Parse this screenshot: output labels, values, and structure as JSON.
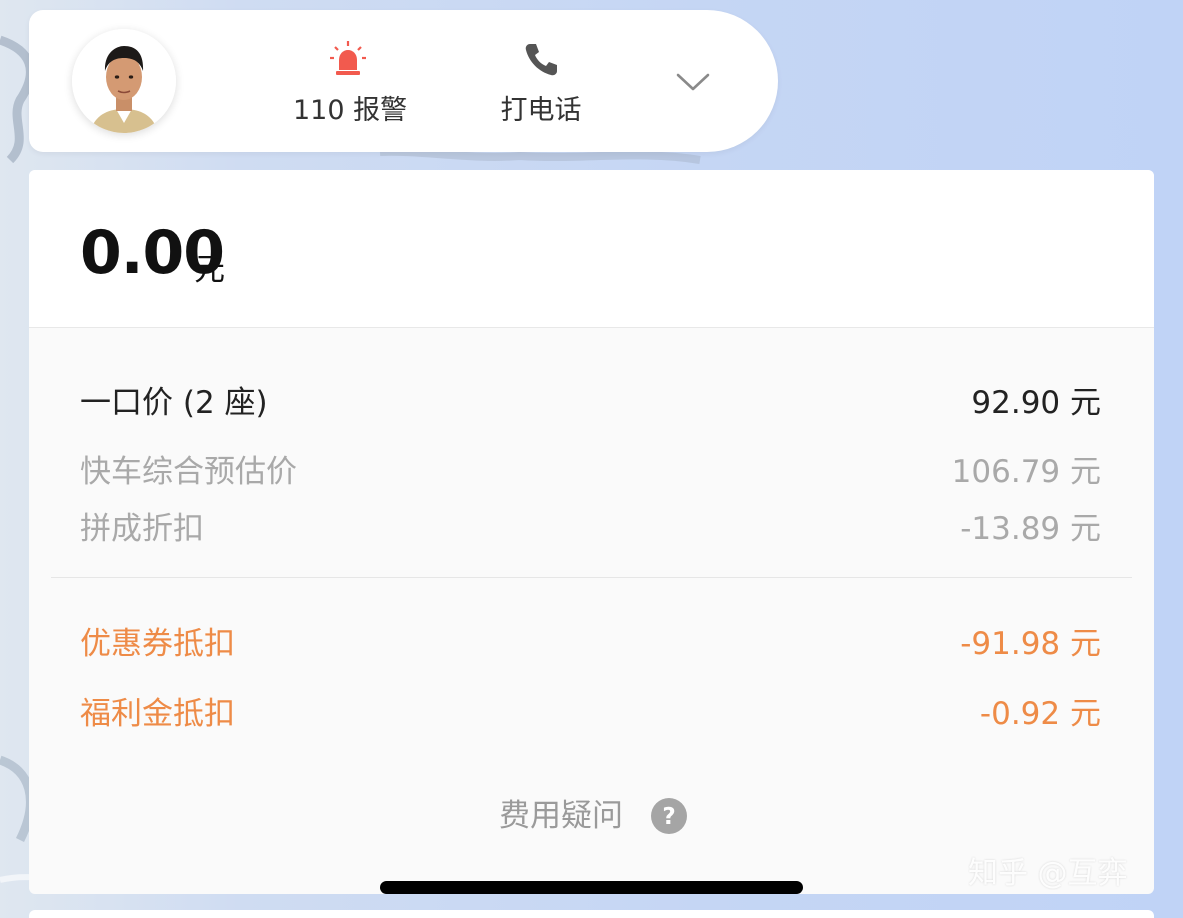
{
  "top_bar": {
    "driver_avatar": "driver-photo",
    "alarm": {
      "icon": "siren-icon",
      "label": "110 报警",
      "color": "#f25a4e"
    },
    "call": {
      "icon": "phone-icon",
      "label": "打电话",
      "color": "#555555"
    },
    "expand_icon": "chevron-down-icon"
  },
  "fare": {
    "total": "0.00",
    "total_unit": "元",
    "rows": [
      {
        "label": "一口价 (2 座)",
        "value": "92.90 元"
      },
      {
        "label": "快车综合预估价",
        "value": "106.79 元"
      },
      {
        "label": "拼成折扣",
        "value": "-13.89 元"
      },
      {
        "label": "优惠券抵扣",
        "value": "-91.98 元"
      },
      {
        "label": "福利金抵扣",
        "value": "-0.92 元"
      }
    ],
    "help_label": "费用疑问",
    "help_icon": "question-circle-icon",
    "discount_color": "#ee8b47"
  },
  "watermark": "知乎 @互弈"
}
